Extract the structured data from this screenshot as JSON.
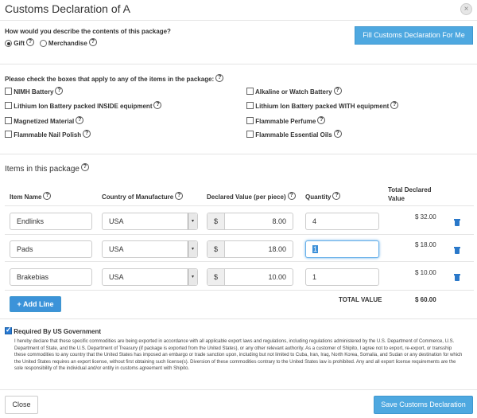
{
  "dialog": {
    "title": "Customs Declaration of A",
    "close_symbol": "×"
  },
  "contents": {
    "question": "How would you describe the contents of this package?",
    "help": "?",
    "options": [
      {
        "label": "Gift",
        "selected": true
      },
      {
        "label": "Merchandise",
        "selected": false
      }
    ],
    "fill_button": "Fill Customs Declaration For Me"
  },
  "hazards": {
    "prompt": "Please check the boxes that apply to any of the items in the package:",
    "items": [
      {
        "label": "NIMH Battery",
        "checked": false
      },
      {
        "label": "Alkaline or Watch Battery",
        "checked": false
      },
      {
        "label": "Lithium Ion Battery packed INSIDE equipment",
        "checked": false
      },
      {
        "label": "Lithium Ion Battery packed WITH equipment",
        "checked": false
      },
      {
        "label": "Magnetized Material",
        "checked": false
      },
      {
        "label": "Flammable Perfume",
        "checked": false
      },
      {
        "label": "Flammable Nail Polish",
        "checked": false
      },
      {
        "label": "Flammable Essential Oils",
        "checked": false
      }
    ]
  },
  "items_section": {
    "heading": "Items in this package",
    "columns": {
      "name": "Item Name",
      "country": "Country of Manufacture",
      "value": "Declared Value (per piece)",
      "quantity": "Quantity",
      "total_line1": "Total Declared",
      "total_line2": "Value"
    },
    "currency_symbol": "$",
    "select_arrow": "▾",
    "rows": [
      {
        "name": "Endlinks",
        "country": "USA",
        "value": "8.00",
        "quantity": "4",
        "total": "$ 32.00"
      },
      {
        "name": "Pads",
        "country": "USA",
        "value": "18.00",
        "quantity": "1",
        "total": "$ 18.00"
      },
      {
        "name": "Brakebias",
        "country": "USA",
        "value": "10.00",
        "quantity": "1",
        "total": "$ 10.00"
      }
    ],
    "add_line": "+ Add Line",
    "total_label": "TOTAL VALUE",
    "total_value": "$ 60.00"
  },
  "government": {
    "checked": true,
    "label": "Required By US Government",
    "text": "I hereby declare that these specific commodities are being exported in accordance with all applicable export laws and regulations, including regulations administered by the U.S. Department of Commerce, U.S. Department of State, and the U.S. Department of Treasury (if package is exported from the United States), or any other relevant authority. As a customer of Shipito, I agree not to export, re-export, or transship these commodities to any country that the United States has imposed an embargo or trade sanction upon, including but not limited to Cuba, Iran, Iraq, North Korea, Somalia, and Sudan or any destination for which the United States requires an export license, without first obtaining such license(s). Diversion of these commodities contrary to the United States law is prohibited. Any and all export license requirements are the sole responsibility of the individual and/or entity in customs agreement with Shipito."
  },
  "footer": {
    "close": "Close",
    "save": "Save Customs Declaration"
  }
}
